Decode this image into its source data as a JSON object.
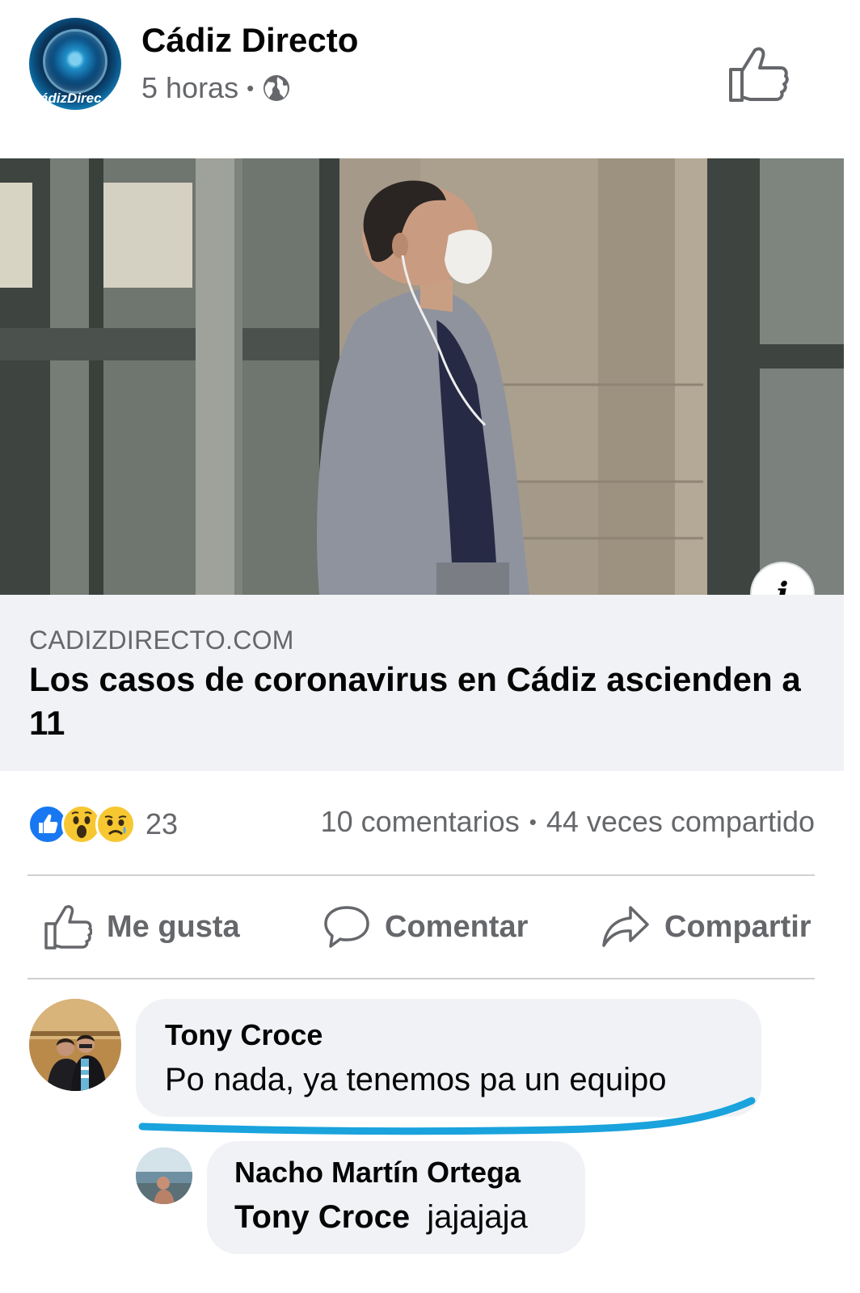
{
  "post": {
    "page_name": "Cádiz Directo",
    "avatar_text": "ádizDirec",
    "time": "5 horas",
    "separator": "•",
    "privacy_icon": "globe-icon",
    "page_like_icon": "thumbs-up-icon"
  },
  "link_preview": {
    "domain": "CADIZDIRECTO.COM",
    "title": "Los casos de coronavirus en Cádiz ascienden a 11",
    "info_label": "i"
  },
  "engagement": {
    "reactions": [
      "like",
      "wow",
      "sad"
    ],
    "reaction_count": "23",
    "comments": "10 comentarios",
    "separator": "•",
    "shares": "44 veces compartido"
  },
  "actions": {
    "like": "Me gusta",
    "comment": "Comentar",
    "share": "Compartir"
  },
  "comments": [
    {
      "author": "Tony Croce",
      "text": "Po nada, ya tenemos pa un equipo",
      "highlight_color": "#1aa3dc"
    }
  ],
  "replies": [
    {
      "author": "Nacho Martín Ortega",
      "mention": "Tony Croce",
      "text": "jajajaja"
    }
  ],
  "colors": {
    "primary_text": "#050505",
    "secondary_text": "#65676b",
    "bubble_bg": "#f0f2f5",
    "like_blue": "#1877f2",
    "reaction_yellow": "#f7c731"
  }
}
